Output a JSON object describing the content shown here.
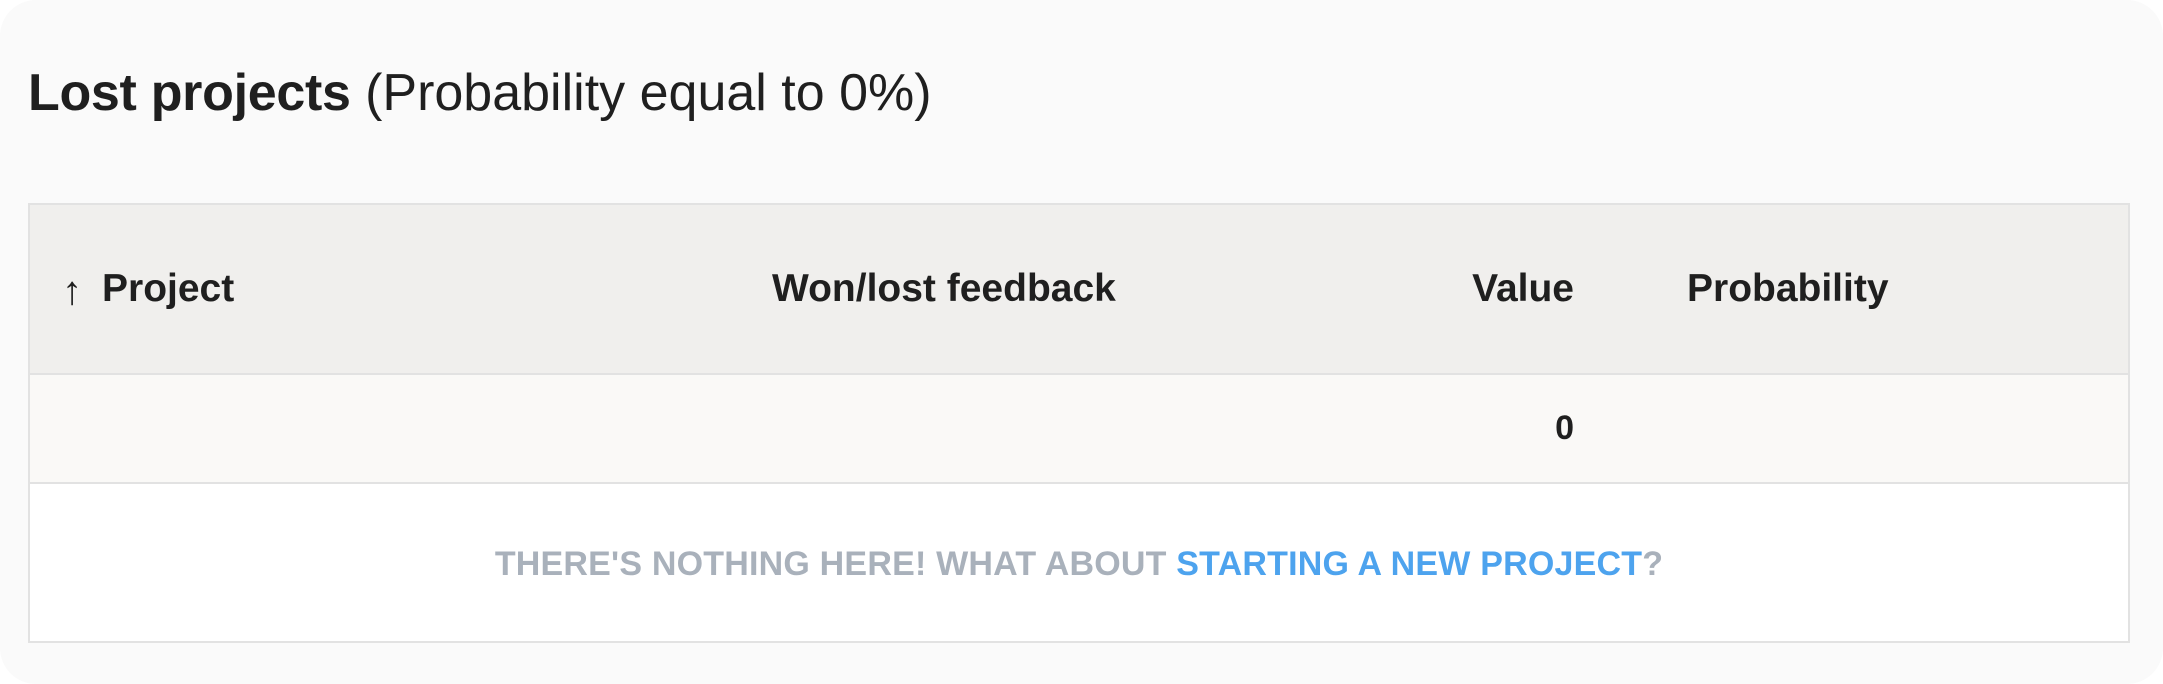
{
  "section": {
    "title": "Lost projects",
    "subtitle": "(Probability equal to 0%)"
  },
  "table": {
    "sort_indicator": "↑",
    "columns": {
      "project": "Project",
      "feedback": "Won/lost feedback",
      "value": "Value",
      "probability": "Probability"
    },
    "total_value": "0",
    "empty_state": {
      "text_before": "THERE'S NOTHING HERE! WHAT ABOUT ",
      "link_label": "STARTING A NEW PROJECT",
      "text_after": "?"
    }
  },
  "colors": {
    "background": "#fafafa",
    "header_background": "#f0efed",
    "empty_text": "#a9b1bb",
    "link": "#4da3ee"
  },
  "icons": {
    "sort": "arrow-up-icon"
  }
}
